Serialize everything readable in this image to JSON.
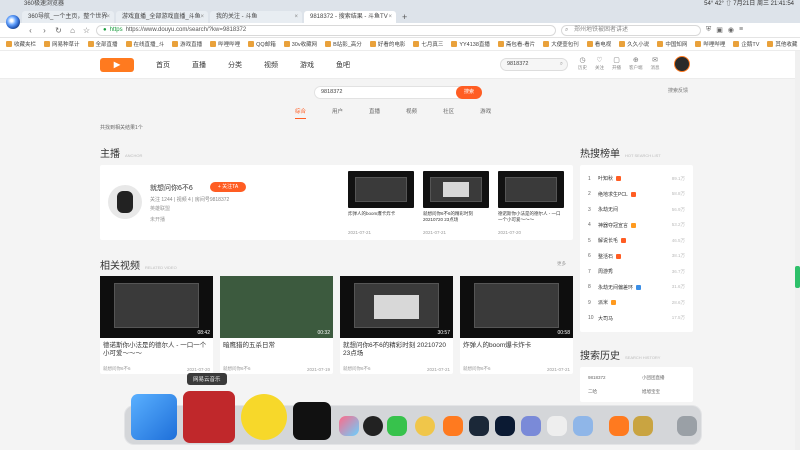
{
  "window": {
    "app_title": "360极速浏览器",
    "sysinfo": "54° 42° ⇧ 7月21日 周三 21:41:54"
  },
  "tabs": [
    {
      "label": "360导航_一个主页，整个世界"
    },
    {
      "label": "游戏直播_全部游戏直播_斗鱼"
    },
    {
      "label": "我的关注 - 斗鱼"
    },
    {
      "label": "9818372 - 搜索结果 - 斗鱼TV",
      "active": true
    }
  ],
  "toolbar": {
    "url": "https://www.douyu.com/search/?kw=9818372",
    "https": "https",
    "search_placeholder": "郑州地铁被困者讲述",
    "icons": [
      "shield-icon",
      "game-icon",
      "profile-icon",
      "menu-icon"
    ]
  },
  "bookmarks": [
    "收藏夹栏",
    "网易种草计",
    "全部直播",
    "在线直播_斗",
    "游戏直播",
    "哔哩哔哩",
    "QQ邮箱",
    "30v收藏网",
    "B站影_高分",
    "好看的电影",
    "七月真三",
    "YY4138直播",
    "斋包看-看片",
    "大便壹包刊",
    "看电视",
    "久久小说",
    "中国知网",
    "哔哩哔哩",
    "企鹅TV",
    "其他收藏"
  ],
  "site": {
    "nav": [
      "首页",
      "直播",
      "分类",
      "视频",
      "游戏",
      "鱼吧"
    ],
    "search_value": "9818372",
    "user_icons": [
      {
        "g": "◷",
        "l": "历史"
      },
      {
        "g": "♡",
        "l": "关注"
      },
      {
        "g": "▢",
        "l": "开播"
      },
      {
        "g": "⊕",
        "l": "客户端"
      },
      {
        "g": "✉",
        "l": "消息"
      }
    ],
    "search_button": "搜索",
    "feedback": "搜索反馈",
    "search_tabs": [
      "综合",
      "用户",
      "直播",
      "视频",
      "社区",
      "游戏"
    ],
    "hint": "共找到相关结果1个"
  },
  "anchor": {
    "section_title": "主播",
    "section_sub": "ANCHOR",
    "name": "就想问你6不6",
    "follow": "+ 关注TA",
    "stats": "关注 1244 | 视频 4 | 房间号9818372",
    "game": "英雄联盟",
    "status": "未开播",
    "videos": [
      {
        "title": "炸弹人的boom爆卡炸卡",
        "date": "2021-07-21"
      },
      {
        "title": "就想问你6不6的精彩时刻 20210720 23点场",
        "date": "2021-07-21"
      },
      {
        "title": "德诺斯你小法是的德尔人 - 一口一个小可爱～～～",
        "date": "2021-07-20"
      }
    ]
  },
  "related": {
    "section_title": "相关视频",
    "section_sub": "RELATED VIDEO",
    "more": "更多",
    "videos": [
      {
        "title": "德诺斯你小法是的德尔人 - 一口一个小可爱～～～",
        "author": "就想问你6不6",
        "date": "2021-07-20",
        "duration": "08:42"
      },
      {
        "title": "暗鹰猎的五杀日常",
        "author": "就想问你6不6",
        "date": "2021-07-19",
        "duration": "00:32"
      },
      {
        "title": "就想问你6不6的精彩时刻 20210720 23点场",
        "author": "就想问你6不6",
        "date": "2021-07-21",
        "duration": "30:57"
      },
      {
        "title": "炸弹人的boom爆卡炸卡",
        "author": "就想问你6不6",
        "date": "2021-07-21",
        "duration": "00:58"
      }
    ]
  },
  "hot": {
    "title": "热搜榜单",
    "sub": "HOT SEARCH LIST",
    "items": [
      {
        "n": "1",
        "t": "叶知秋",
        "c": "89.1万",
        "tag": "#ff5d23"
      },
      {
        "n": "2",
        "t": "绝地求生PCL",
        "c": "58.8万",
        "tag": "#ff5d23"
      },
      {
        "n": "3",
        "t": "永劫无间",
        "c": "56.9万",
        "tag": ""
      },
      {
        "n": "4",
        "t": "神器夺冠宣言",
        "c": "53.2万",
        "tag": "#ff9a1f"
      },
      {
        "n": "5",
        "t": "解说长毛",
        "c": "46.5万",
        "tag": "#ff5d23"
      },
      {
        "n": "6",
        "t": "整活石",
        "c": "38.1万",
        "tag": "#ff5d23"
      },
      {
        "n": "7",
        "t": "周游秀",
        "c": "36.7万",
        "tag": ""
      },
      {
        "n": "8",
        "t": "永劫无间偏差环",
        "c": "31.6万",
        "tag": "#3a8ee6"
      },
      {
        "n": "9",
        "t": "派米",
        "c": "28.6万",
        "tag": "#ff9a1f"
      },
      {
        "n": "10",
        "t": "大司马",
        "c": "17.5万",
        "tag": ""
      }
    ]
  },
  "history": {
    "title": "搜索历史",
    "sub": "SEARCH HISTORY",
    "items": [
      "9818372",
      "小团团直播",
      "二哈",
      "旭旭宝宝",
      "优惠嫂",
      "文韬"
    ]
  },
  "dock": {
    "tooltip": "网易云音乐"
  }
}
